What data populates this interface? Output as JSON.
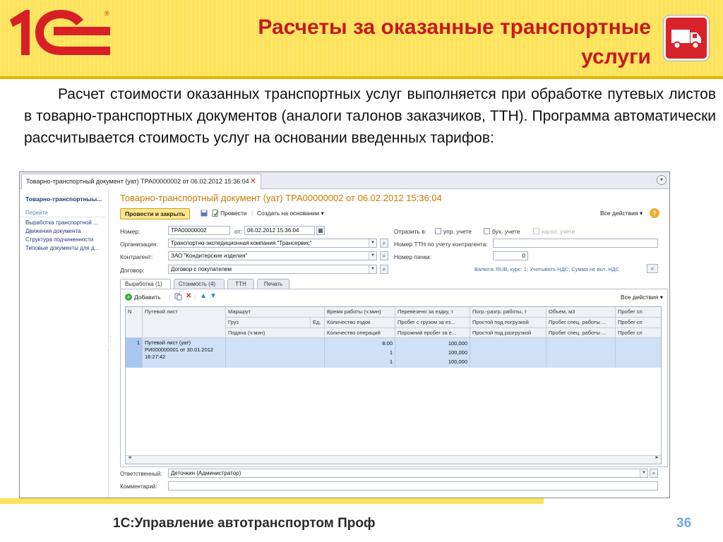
{
  "slide": {
    "logo_text": "1С",
    "logo_reg": "®",
    "title": "Расчеты за оказанные транспортные услуги",
    "title_line1": "Расчеты за оказанные транспортные",
    "title_line2": "услуги",
    "truck_icon": "truck-icon",
    "paragraph": "Расчет стоимости оказанных транспортных услуг выполняется при обработке путевых листов в товарно-транспортных документов (аналоги талонов заказчиков, ТТН). Программа автоматически рассчитывается стоимость услуг на основании введенных тарифов:",
    "footer": "1С:Управление автотранспортом Проф",
    "page_number": "36",
    "colors": {
      "title": "#c8181e",
      "header_bg": "#fde35a",
      "accent": "#e8b400",
      "page_no": "#6fa8dc"
    }
  },
  "window": {
    "tab_label": "Товарно-транспортный документ (уат) ТРА00000002 от 06.02.2012 15:36:04",
    "close": "✕",
    "left_panel": {
      "title": "Товарно-транспортныы...",
      "section": "Перейти",
      "items": [
        "Выработка транспортной ...",
        "Движения документа",
        "Структура подчиненности",
        "Типовые документы для д..."
      ]
    },
    "doc_title": "Товарно-транспортный документ (уат) ТРА00000002 от 06.02.2012 15:36:04",
    "toolbar": {
      "post_close": "Провести и закрыть",
      "post": "Провести",
      "create_based": "Создать на основании ▾",
      "all_actions": "Все действия ▾",
      "help": "?"
    },
    "form": {
      "number_label": "Номер:",
      "number": "ТРА00000002",
      "from_label": "от:",
      "date": "06.02.2012 15:36:04",
      "reflect_label": "Отразить в:",
      "mgmt": "упр. учете",
      "acct": "бух. учете",
      "tax": "налог. учете",
      "org_label": "Организация:",
      "org": "Транспортно-экспедиционная компания \"Трансервис\"",
      "ttn_label": "Номер ТТН по учету контрагента:",
      "contractor_label": "Контрагент:",
      "contractor": "ЗАО \"Кондитерские изделия\"",
      "pack_label": "Номер пачки:",
      "pack": "0",
      "contract_label": "Договор:",
      "contract": "Договор с покупателем",
      "currency": "Валюта: RUB, курс: 1; Учитывать НДС; Сумма не вкл. НДС"
    },
    "subtabs": [
      "Выработка (1)",
      "Стоимость (4)",
      "ТТН",
      "Печать"
    ],
    "panel_toolbar": {
      "add": "Добавить",
      "all_actions": "Все действия ▾"
    },
    "grid": {
      "headers_row1": [
        "N",
        "Путевой лист",
        "Маршрут",
        "Время работы (ч:мин)",
        "Перевезено за ездку, т",
        "Погр.-разгр. работы, т",
        "Объем, м3",
        "Пробег сп"
      ],
      "headers_row2": [
        "Груз",
        "Ед.",
        "Количество ездок",
        "Пробег с грузом за ез...",
        "Простой под погрузкой",
        "Пробег спец. работы ...",
        "Пробег сп"
      ],
      "headers_row3": [
        "Подача (ч:мин)",
        "Количество операций",
        "Порожний пробег за е...",
        "Простой под разгрузкой",
        "Пробег спец. работы ...",
        "Пробег сп"
      ],
      "row": {
        "n": "1",
        "waybill": [
          "Путевой лист (уат)",
          "РИ000000001 от 30.01.2012",
          "16:27:42"
        ],
        "time": [
          "8:00",
          "1",
          "1"
        ],
        "cargo": [
          "100,000",
          "100,000",
          "100,000"
        ]
      }
    },
    "responsible_label": "Ответственный:",
    "responsible": "Деточкин (Администратор)",
    "comment_label": "Комментарий:"
  }
}
